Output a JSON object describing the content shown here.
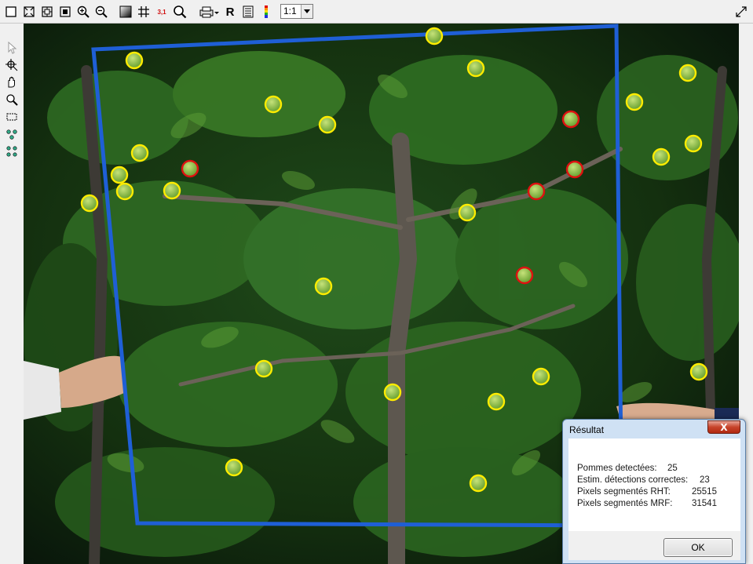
{
  "toolbar": {
    "icons": [
      "select-rect-icon",
      "fit-to-window-icon",
      "actual-size-icon",
      "fit-page-icon",
      "zoom-in-icon",
      "zoom-out-icon",
      "contrast-icon",
      "grid-icon",
      "value-readout-icon",
      "magnifier-icon",
      "print-icon",
      "r-icon",
      "list-icon",
      "color-scale-icon",
      "resize-corner-icon"
    ],
    "value_readout_label": "3,1",
    "r_label": "R",
    "zoom_value": "1:1",
    "zoom_options": [
      "1:1"
    ]
  },
  "sidebar": {
    "tools": [
      "pointer-icon",
      "crosshair-zoom-icon",
      "hand-pan-icon",
      "zoom-tool-icon",
      "rectangle-select-icon",
      "points-tool-icon",
      "multi-points-tool-icon"
    ]
  },
  "image": {
    "description_colors": {
      "frame": "#1f5fd6",
      "correct_detection": "#ffec00",
      "incorrect_detection": "#e01010"
    },
    "detections_yellow_count": 25,
    "detections_red_count": 5
  },
  "dialog": {
    "title": "Résultat",
    "close_label": "X",
    "rows": [
      {
        "label": "Pommes detectées:",
        "value": "25"
      },
      {
        "label": "Estim. détections correctes:",
        "value": "23"
      },
      {
        "label": "Pixels segmentés RHT:",
        "value": "25515"
      },
      {
        "label": "Pixels segmentés MRF:",
        "value": "31541"
      }
    ],
    "ok_label": "OK"
  }
}
